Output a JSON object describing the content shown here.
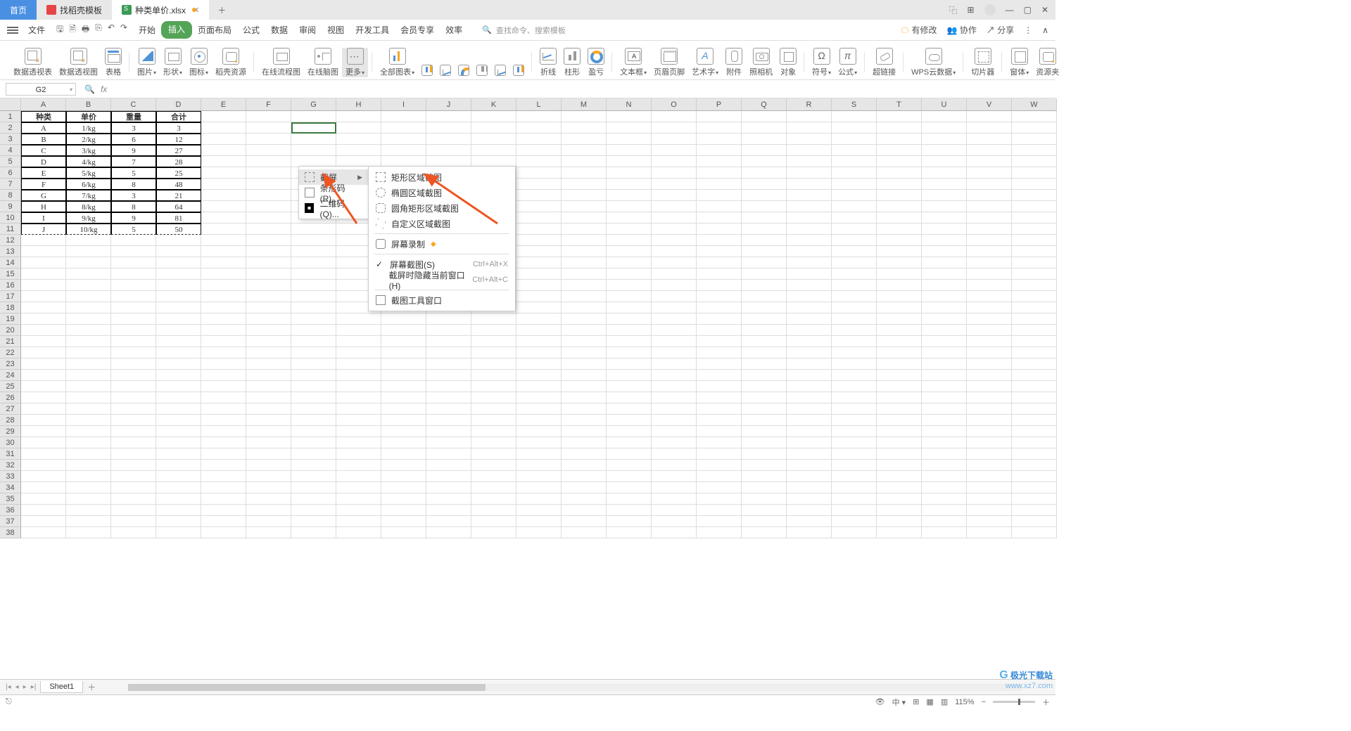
{
  "tabs": {
    "home": "首页",
    "template": "找稻壳模板",
    "file": "种类单价.xlsx"
  },
  "menu": {
    "file": "文件",
    "items": [
      "开始",
      "插入",
      "页面布局",
      "公式",
      "数据",
      "审阅",
      "视图",
      "开发工具",
      "会员专享",
      "效率"
    ],
    "active": 1,
    "search_cmd": "查找命令、搜索模板"
  },
  "menur": {
    "changes": "有修改",
    "collab": "协作",
    "share": "分享"
  },
  "ribbon": {
    "pivot": "数据透视表",
    "pivotchart": "数据透视图",
    "table": "表格",
    "image": "图片",
    "shape": "形状",
    "icons": "图标",
    "res": "稻壳资源",
    "flow": "在线流程图",
    "mind": "在线脑图",
    "more": "更多",
    "charts": "全部图表",
    "line": "折线",
    "bar": "柱形",
    "profit": "盈亏",
    "text": "文本框",
    "hf": "页眉页脚",
    "art": "艺术字",
    "attach": "附件",
    "cam": "照相机",
    "obj": "对象",
    "sym": "符号",
    "eq": "公式",
    "link": "超链接",
    "cloud": "WPS云数据",
    "slicer": "切片器",
    "window": "窗体",
    "resfolder": "资源夹"
  },
  "namebox": "G2",
  "more_menu": {
    "screenshot": "截屏",
    "barcode": "条形码(R)...",
    "qrcode": "二维码(Q)..."
  },
  "shot_menu": {
    "rect": "矩形区域截图",
    "ellipse": "椭圆区域截图",
    "roundrect": "圆角矩形区域截图",
    "custom": "自定义区域截图",
    "record": "屏幕录制",
    "screen": "屏幕截图(S)",
    "screen_sc": "Ctrl+Alt+X",
    "hide": "截屏时隐藏当前窗口(H)",
    "hide_sc": "Ctrl+Alt+C",
    "toolwin": "截图工具窗口"
  },
  "cols": [
    "A",
    "B",
    "C",
    "D",
    "E",
    "F",
    "G",
    "H",
    "I",
    "J",
    "K",
    "L",
    "M",
    "N",
    "O",
    "P",
    "Q",
    "R",
    "S",
    "T",
    "U",
    "V",
    "W"
  ],
  "table": {
    "headers": [
      "种类",
      "单价",
      "重量",
      "合计"
    ],
    "rows": [
      [
        "A",
        "1/kg",
        "3",
        "3"
      ],
      [
        "B",
        "2/kg",
        "6",
        "12"
      ],
      [
        "C",
        "3/kg",
        "9",
        "27"
      ],
      [
        "D",
        "4/kg",
        "7",
        "28"
      ],
      [
        "E",
        "5/kg",
        "5",
        "25"
      ],
      [
        "F",
        "6/kg",
        "8",
        "48"
      ],
      [
        "G",
        "7/kg",
        "3",
        "21"
      ],
      [
        "H",
        "8/kg",
        "8",
        "64"
      ],
      [
        "I",
        "9/kg",
        "9",
        "81"
      ],
      [
        "J",
        "10/kg",
        "5",
        "50"
      ]
    ]
  },
  "sheet": "Sheet1",
  "status": {
    "zoom": "115%",
    "views": [
      "⊞",
      "▦",
      "▥"
    ]
  },
  "watermark": {
    "l1": "极光下载站",
    "l2": "www.xz7.com"
  }
}
